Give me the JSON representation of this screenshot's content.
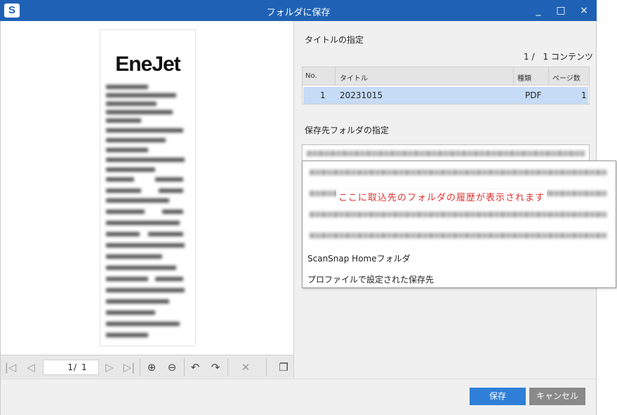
{
  "window": {
    "title": "フォルダに保存",
    "app_icon_glyph": "S",
    "controls": {
      "minimize": "_",
      "maximize": "□",
      "close": "×"
    }
  },
  "preview": {
    "logo_text": "EneJet",
    "toolbar": {
      "current_page": "1",
      "slash": "/",
      "total_pages": "1",
      "icons": [
        "first-page-icon",
        "prev-page-icon",
        "next-page-icon",
        "last-page-icon",
        "zoom-in-icon",
        "zoom-out-icon",
        "rotate-left-icon",
        "rotate-right-icon",
        "delete-page-icon",
        "pages-icon"
      ]
    }
  },
  "title_section": {
    "label": "タイトルの指定",
    "count": "1 /　1 コンテンツ",
    "columns": [
      "No.",
      "タイトル",
      "種類",
      "ページ数"
    ],
    "rows": [
      {
        "no": "1",
        "title": "20231015",
        "type": "PDF",
        "pages": "1"
      }
    ]
  },
  "folder_section": {
    "label": "保存先フォルダの指定",
    "history_note": "ここに取込先のフォルダの履歴が表示されます",
    "items": [
      "ScanSnap Homeフォルダ",
      "プロファイルで設定された保存先"
    ]
  },
  "buttons": {
    "save": "保存",
    "cancel": "キャンセル"
  },
  "colors": {
    "title_bar": "#1f62b5",
    "selected_row": "#c6dcf6",
    "save_button": "#2f7fd8",
    "cancel_button": "#8a8a8a",
    "note_text": "#e03030"
  }
}
